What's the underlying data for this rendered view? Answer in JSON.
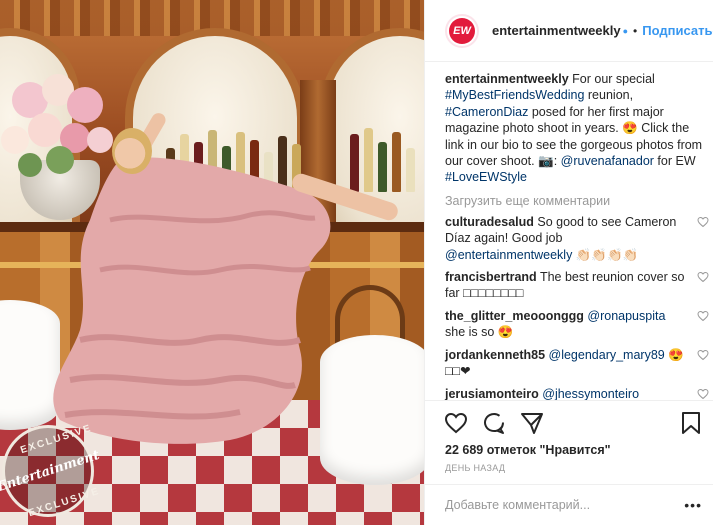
{
  "header": {
    "avatar_text": "EW",
    "username": "entertainmentweekly",
    "verified_icon": "verified-badge-icon",
    "separator": "•",
    "follow_label": "Подписаться"
  },
  "caption": {
    "username": "entertainmentweekly",
    "t1": " For our special ",
    "tag1": "#MyBestFriendsWedding",
    "t2": " reunion, ",
    "tag2": "#CameronDiaz",
    "t3": " posed for her first major magazine photo shoot in years. ",
    "emoji1": "😍",
    "t4": " Click the link in our bio to see the gorgeous photos from our cover shoot. ",
    "camera": "📷",
    "t5": ": ",
    "mention": "@ruvenafanador",
    "t6": " for EW ",
    "tag3": "#LoveEWStyle"
  },
  "load_more": "Загрузить еще комментарии",
  "comments": [
    {
      "user": "culturadesalud",
      "text": " So good to see Cameron Díaz again! Good job ",
      "mention": "@entertainmentweekly",
      "tail": " 👏🏻👏🏻👏🏻👏🏻"
    },
    {
      "user": "francisbertrand",
      "text": " The best reunion cover so far □□□□□□□□",
      "mention": "",
      "tail": ""
    },
    {
      "user": "the_glitter_meooonggg",
      "text": " ",
      "mention": "@ronapuspita",
      "tail": " she is so 😍"
    },
    {
      "user": "jordankenneth85",
      "text": " ",
      "mention": "@legendary_mary89",
      "tail": " 😍□□❤"
    },
    {
      "user": "jerusiamonteiro",
      "text": " ",
      "mention": "@jhessymonteiro",
      "tail": ""
    }
  ],
  "likes": "22 689 отметок \"Нравится\"",
  "time": "ДЕНЬ НАЗАД",
  "add_comment": {
    "placeholder": "Добавьте комментарий..."
  },
  "more_label": "•••",
  "badge": {
    "top": "EXCLUSIVE",
    "brand": "Entertainment",
    "bottom": "EXCLUSIVE"
  },
  "colors": {
    "link": "#003569",
    "follow": "#3897f0",
    "brand": "#e21b3c"
  }
}
